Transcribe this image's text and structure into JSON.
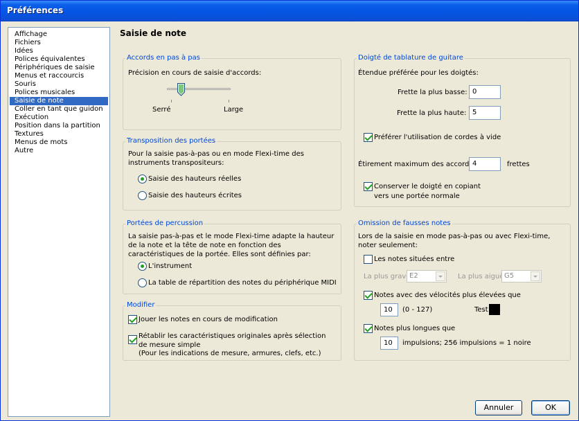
{
  "window": {
    "title": "Préférences"
  },
  "sidebar": {
    "items": [
      "Affichage",
      "Fichiers",
      "Idées",
      "Polices équivalentes",
      "Périphériques de saisie",
      "Menus et raccourcis",
      "Souris",
      "Polices musicales",
      "Saisie de note",
      "Coller en tant que guidon",
      "Exécution",
      "Position dans la partition",
      "Textures",
      "Menus de mots",
      "Autre"
    ],
    "selected": "Saisie de note"
  },
  "page": {
    "title": "Saisie de note"
  },
  "accords": {
    "title": "Accords en pas à pas",
    "label": "Précision en cours de saisie d'accords:",
    "slider_min": "Serré",
    "slider_max": "Large"
  },
  "transposition": {
    "title": "Transposition des portées",
    "desc": "Pour la saisie pas-à-pas ou en mode Flexi-time des instruments transpositeurs:",
    "opt_real": "Saisie des hauteurs réelles",
    "opt_written": "Saisie des hauteurs écrites"
  },
  "percussion": {
    "title": "Portées de percussion",
    "desc": "La saisie pas-à-pas et le mode Flexi-time adapte la hauteur de la note et la tête de note en fonction des caractéristiques de la portée. Elles sont définies par:",
    "opt_instrument": "L'instrument",
    "opt_midi": "La table de répartition des notes du périphérique MIDI"
  },
  "modifier": {
    "title": "Modifier",
    "play_notes": "Jouer les notes en cours de modification",
    "restore_line1": "Rétablir les caractéristiques originales après sélection de mesure simple",
    "restore_line2": "(Pour les indications de mesure, armures, clefs, etc.)"
  },
  "doigte": {
    "title": "Doigté de tablature de guitare",
    "range_label": "Étendue préférée pour les doigtés:",
    "lowest_label": "Frette la plus basse:",
    "lowest_value": "0",
    "highest_label": "Frette la plus haute:",
    "highest_value": "5",
    "open_strings": "Préférer l'utilisation de cordes à vide",
    "stretch_label": "Étirement maximum des accords:",
    "stretch_value": "4",
    "stretch_unit": "frettes",
    "keep_line1": "Conserver le doigté en copiant",
    "keep_line2": "vers une portée normale"
  },
  "omission": {
    "title": "Omission de fausses notes",
    "desc": "Lors de la saisie en mode pas-à-pas ou avec Flexi-time, noter seulement:",
    "between_label": "Les notes situées entre",
    "low_label": "La plus grave",
    "low_value": "E2",
    "high_label": "La plus aiguë",
    "high_value": "G5",
    "velocity_label": "Notes avec des vélocités plus élevées que",
    "velocity_value": "10",
    "velocity_range": "(0 - 127)",
    "test_label": "Test",
    "longer_label": "Notes plus longues que",
    "longer_value": "10",
    "longer_unit": "impulsions; 256 impulsions = 1 noire"
  },
  "buttons": {
    "cancel": "Annuler",
    "ok": "OK"
  },
  "colors": {
    "title_bar": "#0a5ee8",
    "group_title": "#0046d5",
    "selection": "#316ac5",
    "test_swatch": "#000000"
  }
}
